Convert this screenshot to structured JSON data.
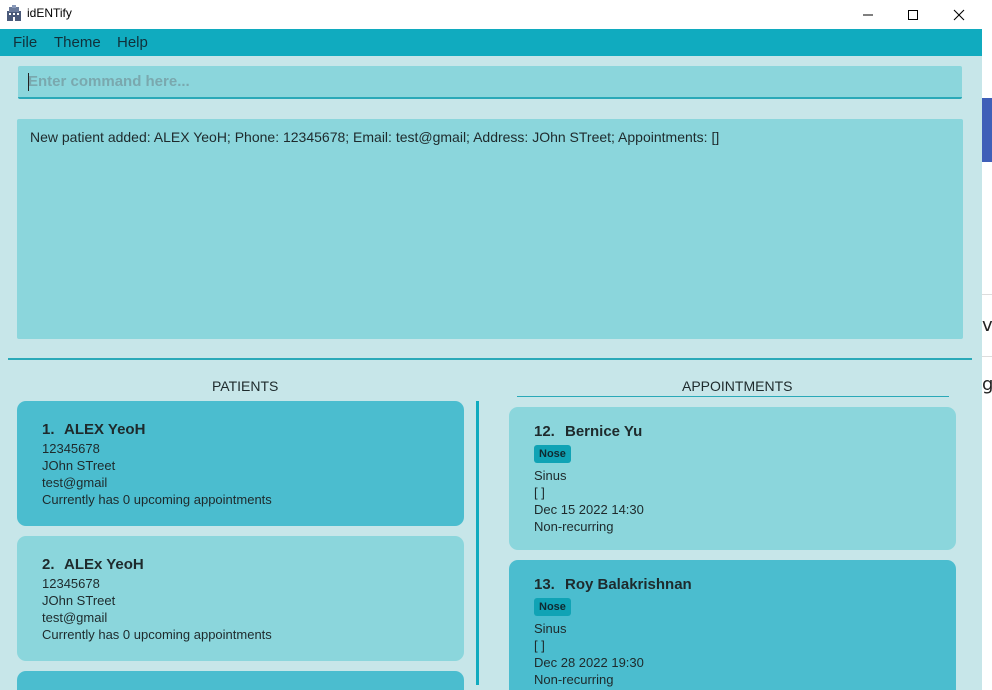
{
  "window": {
    "title": "idENTify"
  },
  "menu": {
    "items": [
      "File",
      "Theme",
      "Help"
    ]
  },
  "command": {
    "placeholder": "Enter command here..."
  },
  "result": {
    "text": "New patient added: ALEX YeoH; Phone: 12345678; Email: test@gmail; Address: JOhn STreet; Appointments: []"
  },
  "patients": {
    "title": "PATIENTS",
    "items": [
      {
        "index": "1.",
        "name": "ALEX YeoH",
        "phone": "12345678",
        "address": "JOhn STreet",
        "email": "test@gmail",
        "status": "Currently has 0 upcoming appointments"
      },
      {
        "index": "2.",
        "name": "ALEx YeoH",
        "phone": "12345678",
        "address": "JOhn STreet",
        "email": "test@gmail",
        "status": "Currently has 0 upcoming appointments"
      }
    ]
  },
  "appointments": {
    "title": "APPOINTMENTS",
    "items": [
      {
        "index": "12.",
        "name": "Bernice Yu",
        "tag": "Nose",
        "reason": "Sinus",
        "tags": "[ ]",
        "datetime": "Dec 15 2022 14:30",
        "recurrence": "Non-recurring"
      },
      {
        "index": "13.",
        "name": "Roy Balakrishnan",
        "tag": "Nose",
        "reason": "Sinus",
        "tags": "[ ]",
        "datetime": "Dec 28 2022 19:30",
        "recurrence": "Non-recurring"
      }
    ]
  },
  "colors": {
    "accent": "#10abbf",
    "card_dark": "#4bbdcf",
    "card_light": "#8bd6dc",
    "background": "#c7e6e9"
  }
}
